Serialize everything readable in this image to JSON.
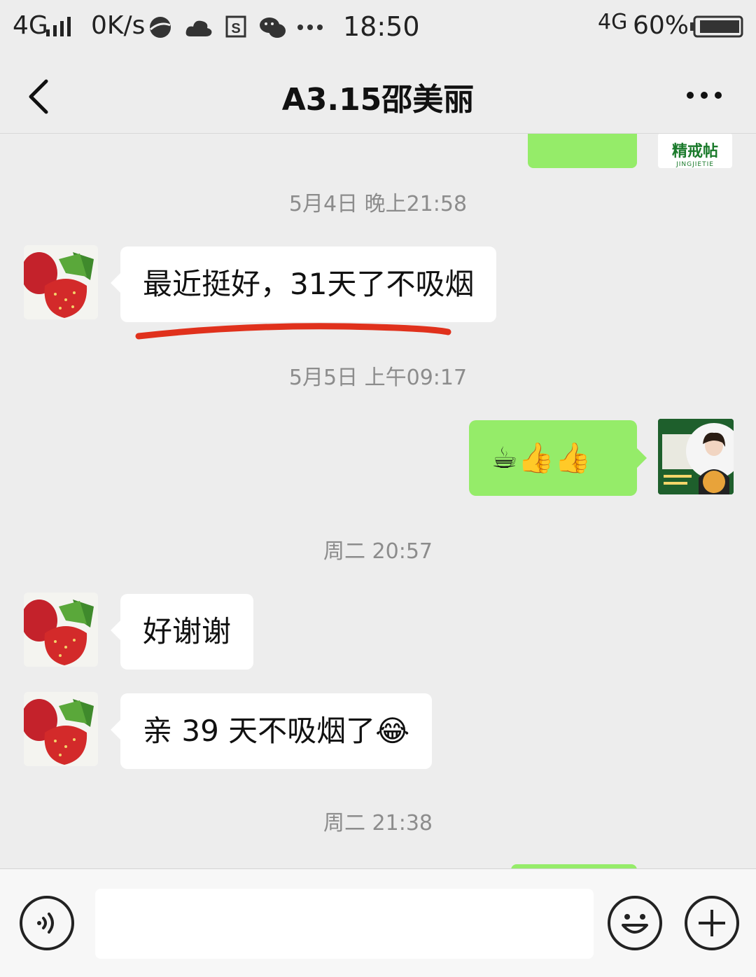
{
  "status_bar": {
    "network_left": "4G",
    "speed": "0K/s",
    "time": "18:50",
    "network_right": "4G",
    "battery": "60%",
    "icons": [
      "signal-icon",
      "browser-icon",
      "cloud-icon",
      "s-app-icon",
      "wechat-icon",
      "more-dots-icon",
      "battery-icon"
    ]
  },
  "header": {
    "title": "A3.15邵美丽"
  },
  "top_card": {
    "brand": "精戒帖",
    "brand_sub": "JINGJIETIE"
  },
  "messages": [
    {
      "type": "timestamp",
      "text": "5月4日 晚上21:58"
    },
    {
      "type": "received",
      "text": "最近挺好，31天了不吸烟",
      "underlined": true
    },
    {
      "type": "timestamp",
      "text": "5月5日 上午09:17"
    },
    {
      "type": "sent",
      "text": "☕👍👍"
    },
    {
      "type": "timestamp",
      "text": "周二 20:57"
    },
    {
      "type": "received",
      "text": "好谢谢"
    },
    {
      "type": "received",
      "text": "亲 39 天不吸烟了😂"
    },
    {
      "type": "timestamp",
      "text": "周二 21:38"
    }
  ],
  "colors": {
    "background": "#ededed",
    "sent_bubble": "#95ec69",
    "received_bubble": "#ffffff",
    "underline": "#e0311c"
  },
  "input_bar": {
    "icons": [
      "voice-icon",
      "emoji-icon",
      "plus-icon"
    ]
  }
}
